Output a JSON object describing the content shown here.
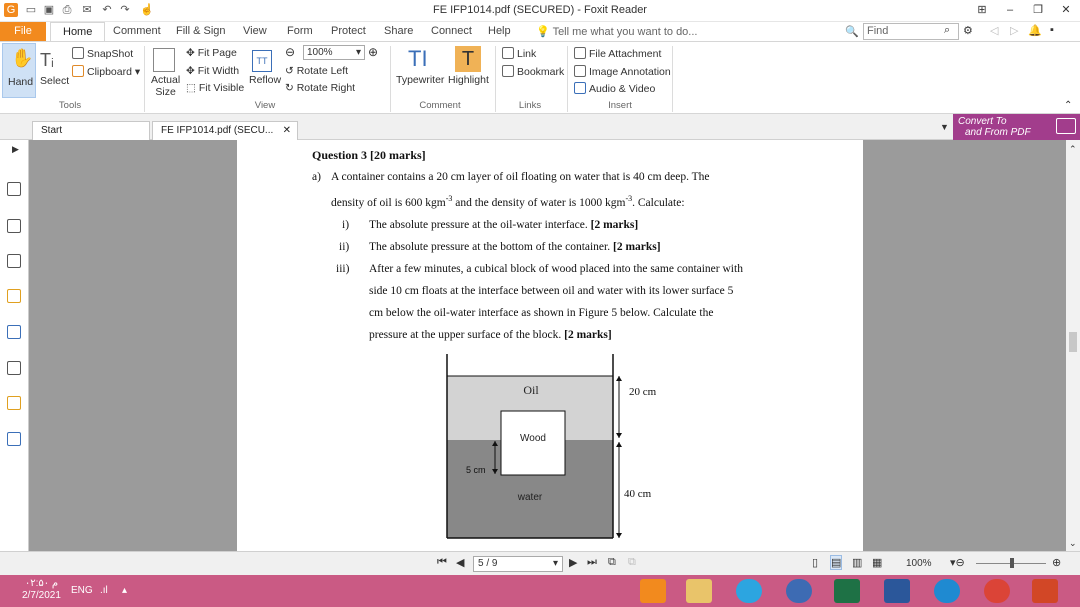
{
  "window": {
    "title": "FE IFP1014.pdf (SECURED) - Foxit Reader"
  },
  "ribbon_tabs": [
    "File",
    "Home",
    "Comment",
    "Fill & Sign",
    "View",
    "Form",
    "Protect",
    "Share",
    "Connect",
    "Help"
  ],
  "tell_me": "Tell me what you want to do...",
  "find_placeholder": "Find",
  "tools": {
    "hand": "Hand",
    "select": "Select",
    "snapshot": "SnapShot",
    "clipboard": "Clipboard",
    "actual_size_1": "Actual",
    "actual_size_2": "Size",
    "fit_page": "Fit Page",
    "fit_width": "Fit Width",
    "fit_visible": "Fit Visible",
    "reflow": "Reflow",
    "zoom": "100%",
    "rotate_left": "Rotate Left",
    "rotate_right": "Rotate Right",
    "typewriter": "Typewriter",
    "highlight": "Highlight",
    "link": "Link",
    "bookmark": "Bookmark",
    "file_attachment": "File Attachment",
    "image_annotation": "Image Annotation",
    "audio_video": "Audio & Video"
  },
  "groups": {
    "tools": "Tools",
    "view": "View",
    "comment": "Comment",
    "links": "Links",
    "insert": "Insert"
  },
  "doc_tabs": {
    "start": "Start",
    "file": "FE IFP1014.pdf (SECU..."
  },
  "convert": {
    "line1": "Convert To",
    "line2": "and From PDF"
  },
  "document": {
    "heading": "Question 3 [20 marks]",
    "a_label": "a)",
    "a_text1": "A container contains a 20 cm layer of oil floating on water that is 40 cm deep. The",
    "a_text2": "density of oil is 600 kgm",
    "sup": "-3",
    "a_text3": " and the density of water is 1000 kgm",
    "a_text4": ". Calculate:",
    "i_label": "i)",
    "i_text": "The absolute pressure at the oil-water interface. ",
    "i_marks": "[2 marks]",
    "ii_label": "ii)",
    "ii_text": "The absolute pressure at the bottom of the container. ",
    "ii_marks": "[2 marks]",
    "iii_label": "iii)",
    "iii_l1": "After a few minutes, a cubical block of wood placed into the same container with",
    "iii_l2": "side 10 cm floats at the interface between oil and water with its lower surface 5",
    "iii_l3": "cm below the oil-water interface as shown in Figure 5 below. Calculate the",
    "iii_l4": "pressure at the upper surface of the block. ",
    "iii_marks": "[2 marks]"
  },
  "figure": {
    "oil": "Oil",
    "wood": "Wood",
    "water": "water",
    "d20": "20 cm",
    "d40": "40 cm",
    "d5": "5 cm"
  },
  "status": {
    "page": "5 / 9",
    "zoom": "100%"
  },
  "taskbar": {
    "time": "م ۰۲:۵۰",
    "date": "2/7/2021",
    "lang": "ENG"
  },
  "colors": {
    "accent": "#f28a1e",
    "taskbar": "#ca5a84",
    "convert": "#a23d8c",
    "oil": "#d3d3d3",
    "water": "#888888"
  }
}
